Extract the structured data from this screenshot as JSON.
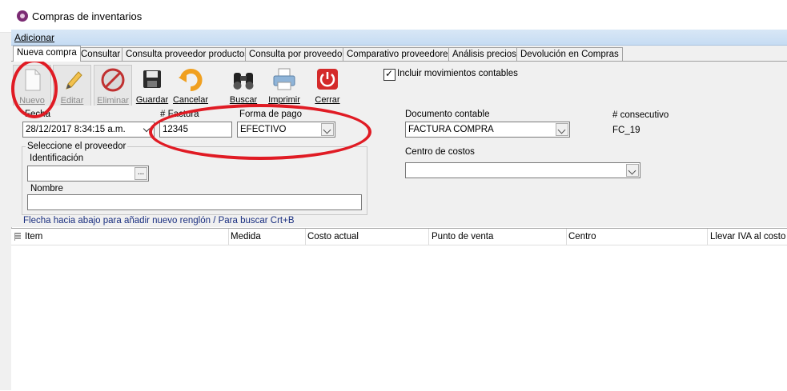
{
  "window": {
    "title": "Compras de inventarios"
  },
  "menu": {
    "items": [
      "Adicionar"
    ]
  },
  "tabs": [
    "Nueva compra",
    "Consultar",
    "Consulta proveedor productos",
    "Consulta por proveedor",
    "Comparativo proveedores",
    "Análisis precios",
    "Devolución en Compras"
  ],
  "toolbar": {
    "nuevo": "Nuevo",
    "editar": "Editar",
    "eliminar": "Eliminar",
    "guardar": "Guardar",
    "cancelar": "Cancelar",
    "buscar": "Buscar",
    "imprimir": "Imprimir",
    "cerrar": "Cerrar",
    "incluir_label": "Incluir movimientos contables",
    "incluir_checked": true
  },
  "form": {
    "fecha_label": "Fecha",
    "fecha_value": "28/12/2017 8:34:15 a.m.",
    "factura_label": "# Factura",
    "factura_value": "12345",
    "forma_pago_label": "Forma de pago",
    "forma_pago_value": "EFECTIVO",
    "documento_label": "Documento contable",
    "documento_value": "FACTURA COMPRA",
    "consecutivo_label": "# consecutivo",
    "consecutivo_value": "FC_19",
    "proveedor_group": "Seleccione el proveedor",
    "identificacion_label": "Identificación",
    "identificacion_value": "",
    "identificacion_btn": "...",
    "nombre_label": "Nombre",
    "nombre_value": "",
    "centro_label": "Centro de costos",
    "centro_value": ""
  },
  "hint": "Flecha hacia abajo para añadir nuevo renglón / Para buscar Crt+B",
  "grid": {
    "columns": [
      "Item",
      "Medida",
      "Costo actual",
      "Punto de venta",
      "Centro",
      "Llevar IVA al costo"
    ]
  },
  "colors": {
    "annotation": "#e01b24",
    "menubar": "#c6dcf3",
    "hint_text": "#1a2f80"
  }
}
